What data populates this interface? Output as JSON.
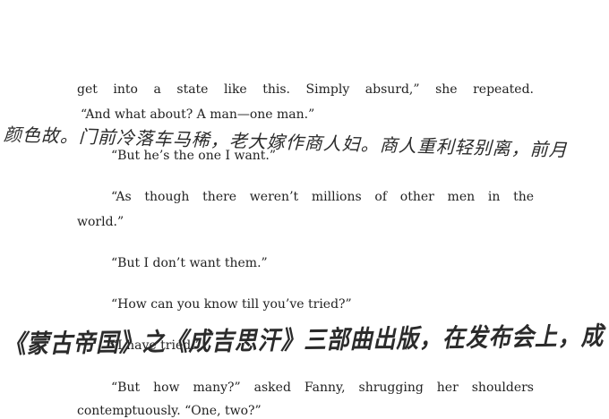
{
  "text_lines": [
    "get into a state like this. Simply absurd,” she repeated.",
    "“And what about? A man—one man.”",
    "“But he’s the one I want.”",
    "“As though there weren’t millions of other men in the",
    "world.”",
    "“But I don’t want them.”",
    "“How can you know till you’ve tried?”",
    "“I have tried.”",
    "“But how many?” asked Fanny, shrugging her shoulders",
    "contemptuously. “One, two?”"
  ],
  "handwriting": [
    "颜色故。门前冷落车马稀，老大嫁作商人妇。商人重利轻别离，前月",
    "《蒙古帝国》之《成吉思汗》三部曲出版，在发布会上，成"
  ]
}
